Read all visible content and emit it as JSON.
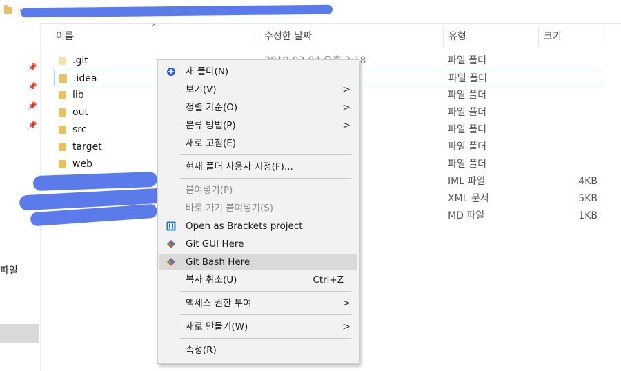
{
  "columns": {
    "name": "이름",
    "date": "수정한 날짜",
    "type": "유형",
    "size": "크기"
  },
  "files": [
    {
      "name": ".git",
      "date": "2019-02-04 오후 3:18",
      "type": "파일 폴더",
      "size": ""
    },
    {
      "name": ".idea",
      "date": "",
      "type": "파일 폴더",
      "size": ""
    },
    {
      "name": "lib",
      "date": "",
      "type": "파일 폴더",
      "size": ""
    },
    {
      "name": "out",
      "date": "",
      "type": "파일 폴더",
      "size": ""
    },
    {
      "name": "src",
      "date": "",
      "type": "파일 폴더",
      "size": ""
    },
    {
      "name": "target",
      "date": "",
      "type": "파일 폴더",
      "size": ""
    },
    {
      "name": "web",
      "date": "",
      "type": "파일 폴더",
      "size": ""
    },
    {
      "name": "",
      "date": "",
      "type": "IML 파일",
      "size": "4KB"
    },
    {
      "name": "",
      "date": "",
      "type": "XML 문서",
      "size": "5KB"
    },
    {
      "name": "",
      "date": "",
      "type": "MD 파일",
      "size": "1KB"
    }
  ],
  "nav": {
    "label": "파일"
  },
  "context_menu": {
    "new_folder": "새 폴더(N)",
    "view": "보기(V)",
    "sort_by": "정렬 기준(O)",
    "group_by": "분류 방법(P)",
    "refresh": "새로 고침(E)",
    "customize": "현재 폴더 사용자 지정(F)...",
    "paste": "붙여넣기(P)",
    "paste_shortcut": "바로 가기 붙여넣기(S)",
    "brackets": "Open as Brackets project",
    "git_gui": "Git GUI Here",
    "git_bash": "Git Bash Here",
    "undo": "복사 취소(U)",
    "undo_accel": "Ctrl+Z",
    "access": "액세스 권한 부여",
    "new": "새로 만들기(W)",
    "properties": "속성(R)"
  },
  "colors": {
    "selection_border": "#99d1ff",
    "folder": "#e9c163",
    "redaction": "#5b7bea",
    "menu_bg": "#f2f2f2",
    "menu_hover": "#d9d9d9"
  }
}
